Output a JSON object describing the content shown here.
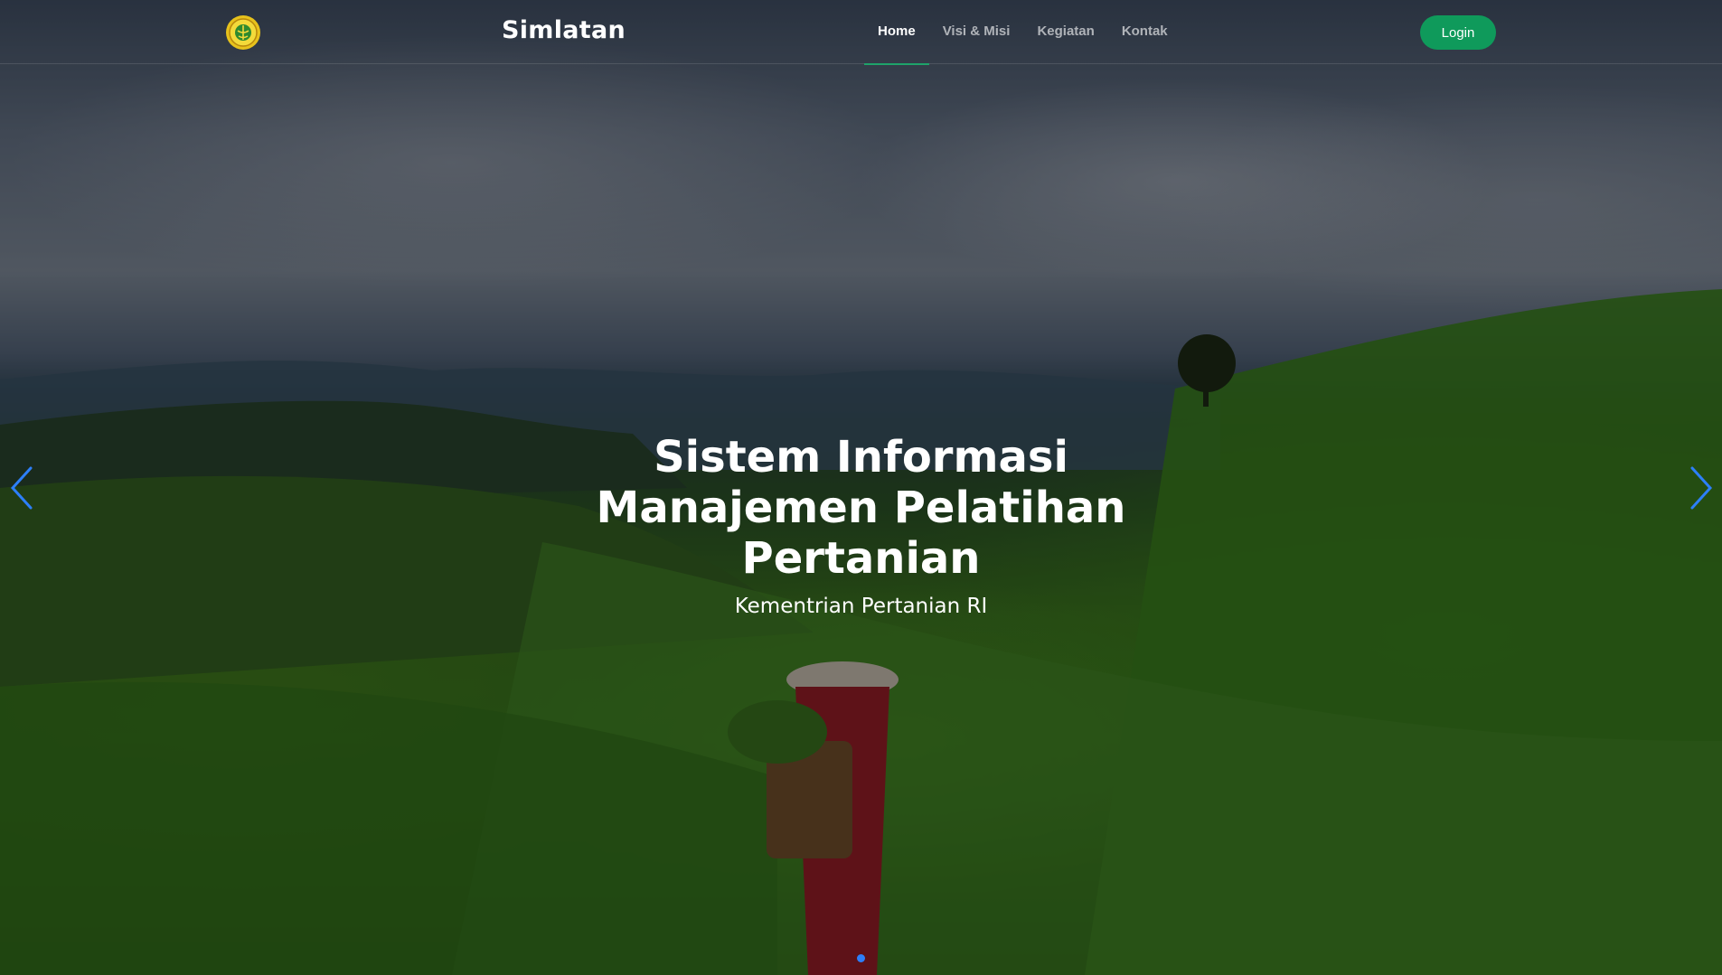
{
  "brand": {
    "name": "Simlatan",
    "logo_icon": "ministry-of-agriculture-emblem-icon"
  },
  "nav": {
    "items": [
      {
        "label": "Home",
        "active": true
      },
      {
        "label": "Visi & Misi",
        "active": false
      },
      {
        "label": "Kegiatan",
        "active": false
      },
      {
        "label": "Kontak",
        "active": false
      }
    ],
    "login_label": "Login"
  },
  "hero": {
    "title": "Sistem Informasi Manajemen Pelatihan Pertanian",
    "subtitle": "Kementrian Pertanian RI",
    "prev_icon": "chevron-left-icon",
    "next_icon": "chevron-right-icon",
    "slide_count": 1,
    "active_slide": 1
  },
  "colors": {
    "accent": "#0f9a5b",
    "active_underline": "#1ea36a",
    "carousel_control": "#2d7ff9"
  }
}
